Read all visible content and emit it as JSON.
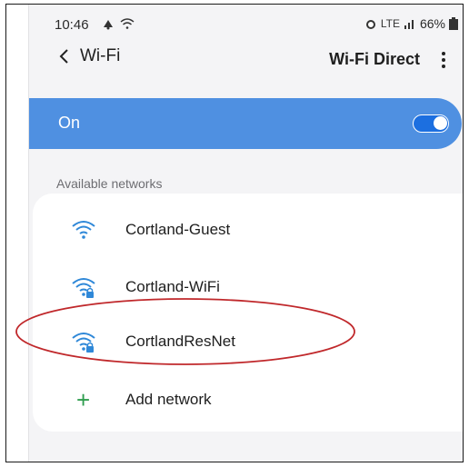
{
  "status_bar": {
    "time": "10:46",
    "network_type": "LTE",
    "battery": "66%"
  },
  "header": {
    "back_label": "Wi-Fi",
    "wifi_direct_label": "Wi-Fi Direct"
  },
  "wifi_toggle": {
    "label": "On",
    "state": "on",
    "bar_color": "#4f90e1"
  },
  "networks": {
    "section_title": "Available networks",
    "items": [
      {
        "ssid": "Cortland-Guest",
        "secured": false,
        "icon": "wifi-icon"
      },
      {
        "ssid": "Cortland-WiFi",
        "secured": true,
        "icon": "wifi-lock-icon"
      },
      {
        "ssid": "CortlandResNet",
        "secured": true,
        "icon": "wifi-lock-icon",
        "highlighted": true
      }
    ],
    "add_label": "Add network"
  },
  "colors": {
    "accent": "#1c6fe0",
    "wifi_icon": "#2f88d8",
    "add_icon": "#2e9d4e",
    "annotation": "#c0282b"
  }
}
